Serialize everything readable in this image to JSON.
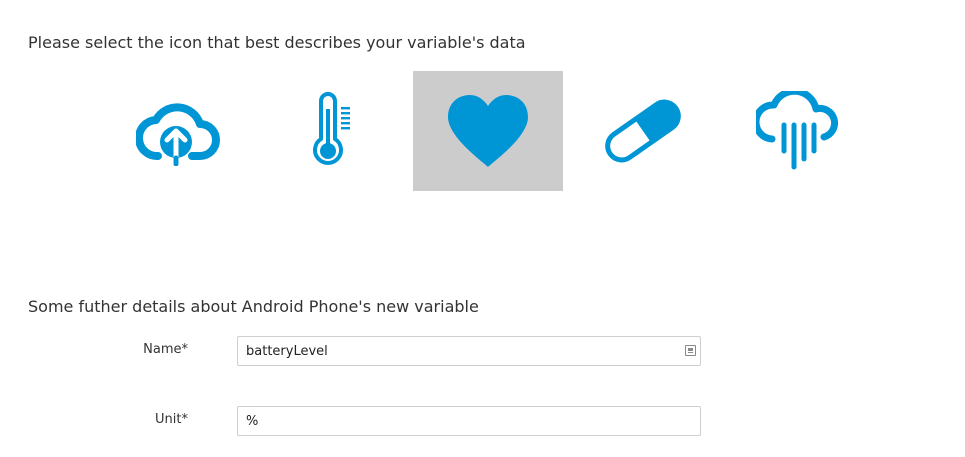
{
  "icon_section": {
    "heading": "Please select the icon that best describes your variable's data",
    "accent_color": "#0096d6",
    "selected_background": "#cccccc",
    "icons": [
      {
        "name": "cloud-upload-icon",
        "selected": false
      },
      {
        "name": "thermometer-icon",
        "selected": false
      },
      {
        "name": "heart-icon",
        "selected": true
      },
      {
        "name": "pill-icon",
        "selected": false
      },
      {
        "name": "rain-cloud-icon",
        "selected": false
      }
    ]
  },
  "details_section": {
    "heading": "Some futher details about Android Phone's new variable",
    "fields": {
      "name": {
        "label": "Name*",
        "value": "batteryLevel"
      },
      "unit": {
        "label": "Unit*",
        "value": "%"
      }
    }
  }
}
